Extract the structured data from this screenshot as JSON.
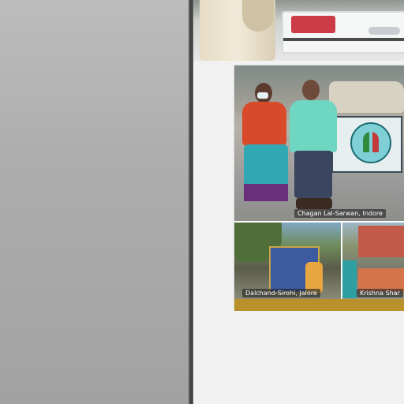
{
  "captions": {
    "main": "Chagan Lal-Sarwan, Indore",
    "bottom_left": "Dalchand-Sirohi, Jalore",
    "bottom_right": "Krishna Shar"
  },
  "colors": {
    "divider": "#4a4a4a",
    "right_background": "#f1f1f1",
    "accent_strip": "#b8912a"
  }
}
